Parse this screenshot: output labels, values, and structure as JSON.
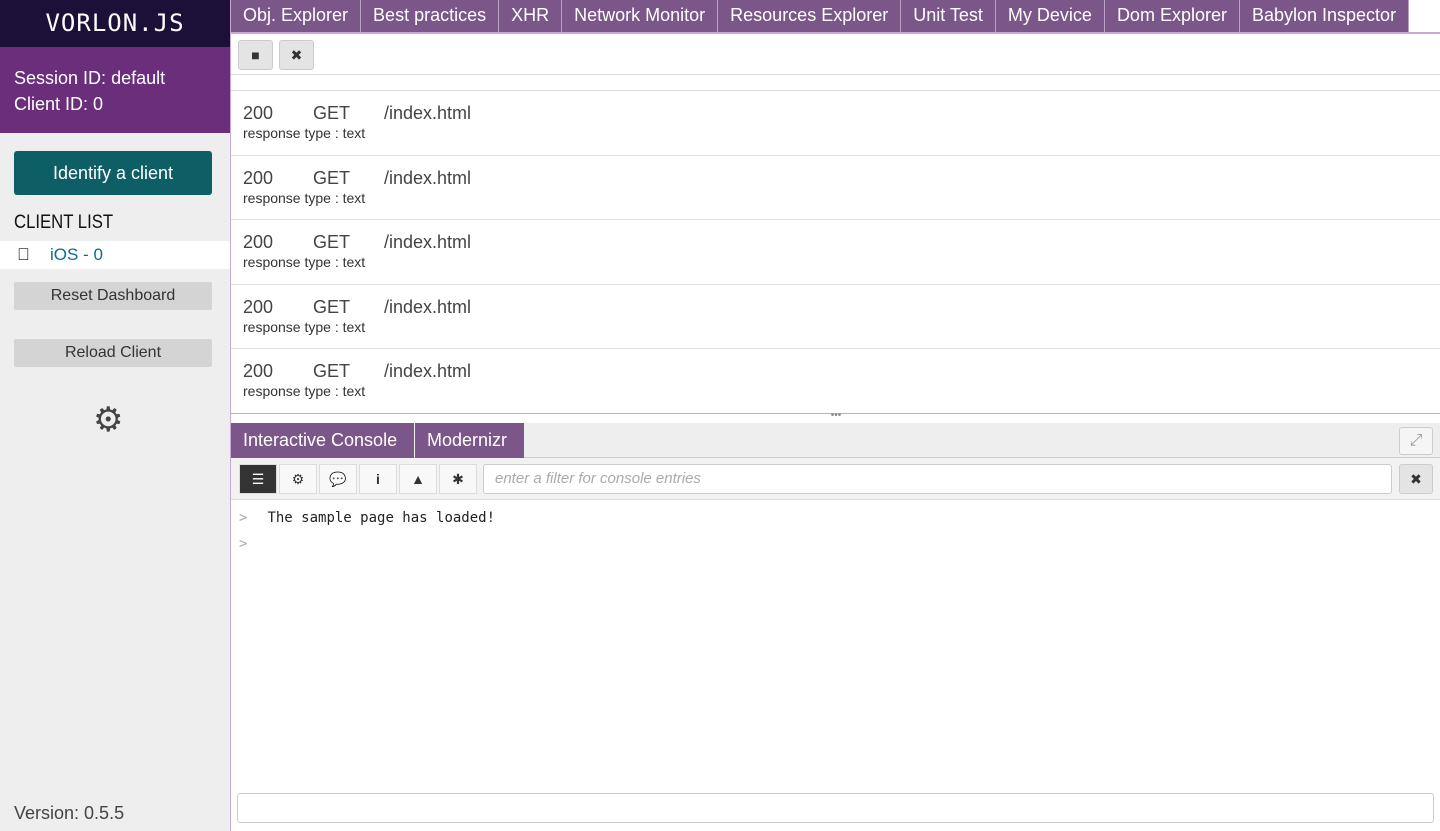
{
  "sidebar": {
    "logo": "VORLON.JS",
    "session_label": "Session ID:",
    "session_value": "default",
    "client_label": "Client ID:",
    "client_value": "0",
    "identify": "Identify a client",
    "client_list_title": "CLIENT LIST",
    "clients": [
      {
        "icon": "apple-icon",
        "label": "iOS - 0"
      }
    ],
    "reset": "Reset Dashboard",
    "reload": "Reload Client",
    "version": "Version: 0.5.5"
  },
  "tabs": [
    "Obj. Explorer",
    "Best practices",
    "XHR",
    "Network Monitor",
    "Resources Explorer",
    "Unit Test",
    "My Device",
    "Dom Explorer",
    "Babylon Inspector"
  ],
  "network": {
    "rows": [
      {
        "status": "200",
        "method": "GET",
        "url": "/index.html",
        "type": "response type : text"
      },
      {
        "status": "200",
        "method": "GET",
        "url": "/index.html",
        "type": "response type : text"
      },
      {
        "status": "200",
        "method": "GET",
        "url": "/index.html",
        "type": "response type : text"
      },
      {
        "status": "200",
        "method": "GET",
        "url": "/index.html",
        "type": "response type : text"
      },
      {
        "status": "200",
        "method": "GET",
        "url": "/index.html",
        "type": "response type : text"
      }
    ]
  },
  "bottom_tabs": [
    "Interactive Console",
    "Modernizr"
  ],
  "console": {
    "filter_placeholder": "enter a filter for console entries",
    "prompt": ">",
    "lines": [
      "The sample page has loaded!",
      ""
    ]
  }
}
